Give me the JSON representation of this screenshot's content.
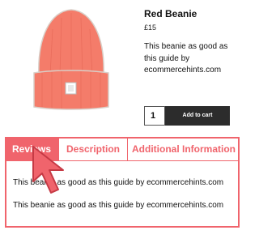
{
  "product": {
    "title": "Red Beanie",
    "price": "£15",
    "description": "This beanie as good as this guide by ecommercehints.com",
    "quantity": "1",
    "add_to_cart_label": "Add to cart",
    "image_icon": "beanie-hat-icon"
  },
  "tabs": [
    {
      "label": "Reviews",
      "active": true
    },
    {
      "label": "Description",
      "active": false
    },
    {
      "label": "Additional Information",
      "active": false
    }
  ],
  "reviews": [
    "This beanie as good as  this guide by ecommercehints.com",
    "This beanie as good as this guide by ecommercehints.com"
  ],
  "colors": {
    "accent": "#f0646c",
    "beanie": "#f47c6a",
    "button": "#2c2c2c"
  }
}
